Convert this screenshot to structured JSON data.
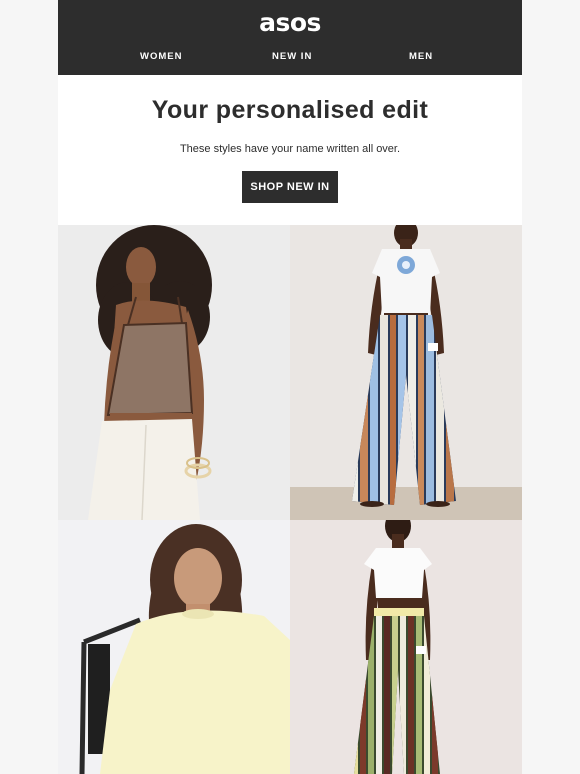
{
  "brand": {
    "logo_text": "asos"
  },
  "nav": {
    "women": "WOMEN",
    "new_in": "NEW IN",
    "men": "MEN"
  },
  "hero": {
    "title": "Your personalised edit",
    "subtitle": "These styles have your name written all over.",
    "cta_label": "SHOP NEW IN"
  },
  "products": [
    {
      "name": "brown-cami-white-jeans"
    },
    {
      "name": "white-tee-striped-trousers"
    },
    {
      "name": "lemon-oversized-tee"
    },
    {
      "name": "white-crop-tee-striped-trousers"
    }
  ],
  "colors": {
    "header_bg": "#2d2d2d",
    "page_bg": "#f6f6f6",
    "text": "#2d2d2d",
    "button_bg": "#2d2d2d"
  }
}
